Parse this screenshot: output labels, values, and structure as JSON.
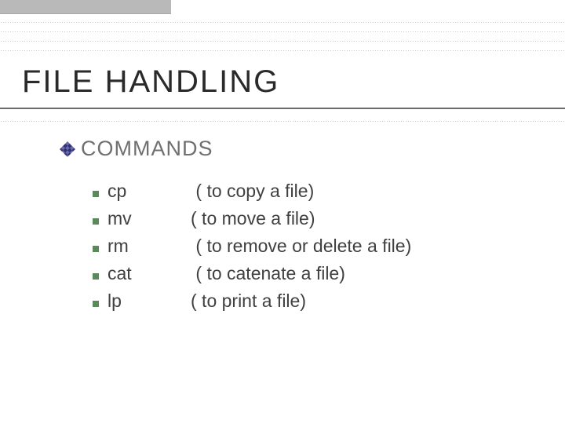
{
  "title": "FILE  HANDLING",
  "subtitle": "COMMANDS",
  "items": [
    {
      "cmd": "cp",
      "desc": " ( to copy a file)"
    },
    {
      "cmd": "mv",
      "desc": "( to move a file)"
    },
    {
      "cmd": "rm",
      "desc": " ( to remove or delete a file)"
    },
    {
      "cmd": "cat",
      "desc": " ( to catenate a file)"
    },
    {
      "cmd": "lp",
      "desc": "( to print a file)"
    }
  ],
  "dotlines_y": [
    28,
    40,
    52,
    64,
    154
  ]
}
